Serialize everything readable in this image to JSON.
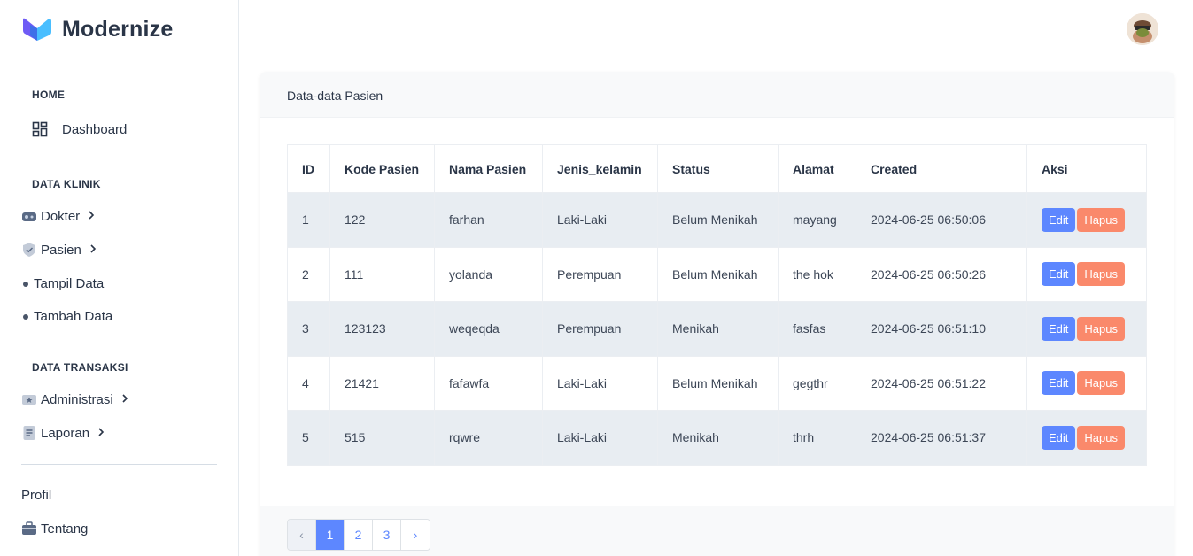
{
  "brand": {
    "name": "Modernize"
  },
  "sidebar": {
    "home_title": "HOME",
    "dashboard_label": "Dashboard",
    "klinik_title": "DATA KLINIK",
    "dokter_label": "Dokter",
    "pasien_label": "Pasien",
    "tampil_label": "Tampil Data",
    "tambah_label": "Tambah Data",
    "transaksi_title": "DATA TRANSAKSI",
    "administrasi_label": "Administrasi",
    "laporan_label": "Laporan",
    "profil_label": "Profil",
    "tentang_label": "Tentang"
  },
  "card": {
    "title": "Data-data Pasien"
  },
  "table": {
    "headers": [
      "ID",
      "Kode Pasien",
      "Nama Pasien",
      "Jenis_kelamin",
      "Status",
      "Alamat",
      "Created",
      "Aksi"
    ],
    "rows": [
      {
        "id": "1",
        "kode": "122",
        "nama": "farhan",
        "jk": "Laki-Laki",
        "status": "Belum Menikah",
        "alamat": "mayang",
        "created": "2024-06-25 06:50:06"
      },
      {
        "id": "2",
        "kode": "111",
        "nama": "yolanda",
        "jk": "Perempuan",
        "status": "Belum Menikah",
        "alamat": "the hok",
        "created": "2024-06-25 06:50:26"
      },
      {
        "id": "3",
        "kode": "123123",
        "nama": "weqeqda",
        "jk": "Perempuan",
        "status": "Menikah",
        "alamat": "fasfas",
        "created": "2024-06-25 06:51:10"
      },
      {
        "id": "4",
        "kode": "21421",
        "nama": "fafawfa",
        "jk": "Laki-Laki",
        "status": "Belum Menikah",
        "alamat": "gegthr",
        "created": "2024-06-25 06:51:22"
      },
      {
        "id": "5",
        "kode": "515",
        "nama": "rqwre",
        "jk": "Laki-Laki",
        "status": "Menikah",
        "alamat": "thrh",
        "created": "2024-06-25 06:51:37"
      }
    ],
    "edit_label": "Edit",
    "hapus_label": "Hapus"
  },
  "pagination": {
    "prev": "‹",
    "pages": [
      "1",
      "2",
      "3"
    ],
    "next": "›",
    "active": "1"
  },
  "colors": {
    "primary": "#5d87ff",
    "danger": "#fa896b",
    "stripe": "#e8edf2"
  }
}
